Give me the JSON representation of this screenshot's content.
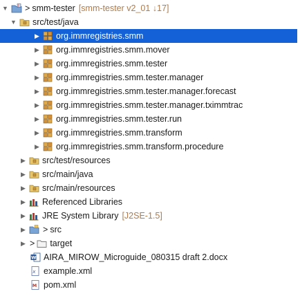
{
  "project": {
    "name": "smm-tester",
    "decoration": "[smm-tester v2_01 ↓17]",
    "prefix": ">"
  },
  "src_test_java": {
    "label": "src/test/java"
  },
  "packages": [
    {
      "label": "org.immregistries.smm",
      "selected": true
    },
    {
      "label": "org.immregistries.smm.mover"
    },
    {
      "label": "org.immregistries.smm.tester"
    },
    {
      "label": "org.immregistries.smm.tester.manager"
    },
    {
      "label": "org.immregistries.smm.tester.manager.forecast"
    },
    {
      "label": "org.immregistries.smm.tester.manager.tximmtrac"
    },
    {
      "label": "org.immregistries.smm.tester.run"
    },
    {
      "label": "org.immregistries.smm.transform"
    },
    {
      "label": "org.immregistries.smm.transform.procedure"
    }
  ],
  "folders": {
    "src_test_resources": "src/test/resources",
    "src_main_java": "src/main/java",
    "src_main_resources": "src/main/resources",
    "referenced_libraries": "Referenced Libraries",
    "jre_label": "JRE System Library",
    "jre_decoration": "[J2SE-1.5]",
    "src_prefix": ">",
    "src": "src",
    "target_prefix": ">",
    "target": "target"
  },
  "files": {
    "docx": "AIRA_MIROW_Microguide_080315 draft 2.docx",
    "example": "example.xml",
    "pom": "pom.xml"
  },
  "colors": {
    "selection": "#1460d6",
    "decoration": "#b07a4a",
    "package_icon": "#c8953a"
  },
  "icons": {
    "expanded": "▼",
    "collapsed": "▶"
  }
}
